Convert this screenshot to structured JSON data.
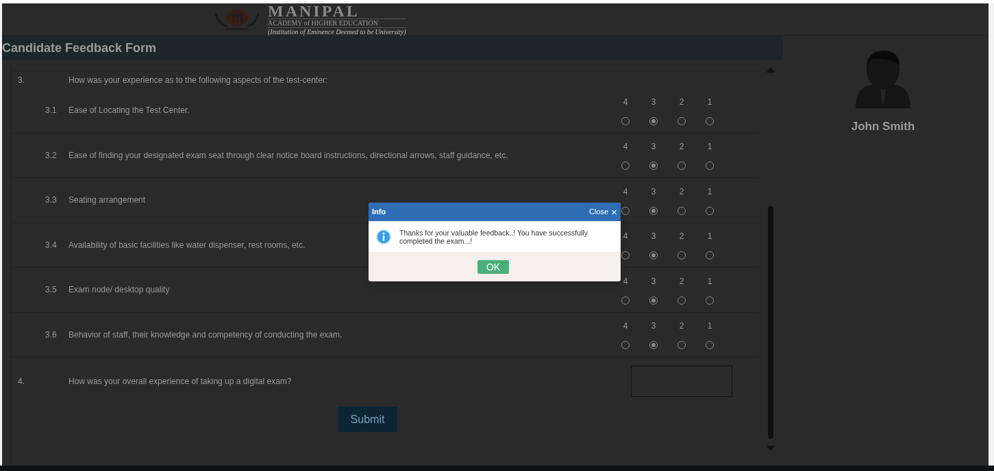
{
  "header": {
    "logo_title": "MANIPAL",
    "logo_subtitle": "ACADEMY of HIGHER EDUCATION",
    "logo_tagline": "(Institution of Eminence Deemed to be University)"
  },
  "form": {
    "title": "Candidate Feedback Form",
    "question": {
      "number": "3.",
      "text": "How was your experience as to the following aspects of the test-center:"
    },
    "items": [
      {
        "number": "3.1",
        "text": "Ease of Locating the Test Center.",
        "options": [
          {
            "label": "4",
            "selected": false
          },
          {
            "label": "3",
            "selected": true
          },
          {
            "label": "2",
            "selected": false
          },
          {
            "label": "1",
            "selected": false
          }
        ]
      },
      {
        "number": "3.2",
        "text": "Ease of finding your designated exam seat through clear notice board instructions, directional arrows, staff guidance, etc.",
        "options": [
          {
            "label": "4",
            "selected": false
          },
          {
            "label": "3",
            "selected": true
          },
          {
            "label": "2",
            "selected": false
          },
          {
            "label": "1",
            "selected": false
          }
        ]
      },
      {
        "number": "3.3",
        "text": "Seating arrangement",
        "options": [
          {
            "label": "4",
            "selected": false
          },
          {
            "label": "3",
            "selected": true
          },
          {
            "label": "2",
            "selected": false
          },
          {
            "label": "1",
            "selected": false
          }
        ]
      },
      {
        "number": "3.4",
        "text": "Availability of basic facilities like water dispenser, rest rooms, etc.",
        "options": [
          {
            "label": "4",
            "selected": false
          },
          {
            "label": "3",
            "selected": true
          },
          {
            "label": "2",
            "selected": false
          },
          {
            "label": "1",
            "selected": false
          }
        ]
      },
      {
        "number": "3.5",
        "text": "Exam node/ desktop quality",
        "options": [
          {
            "label": "4",
            "selected": false
          },
          {
            "label": "3",
            "selected": true
          },
          {
            "label": "2",
            "selected": false
          },
          {
            "label": "1",
            "selected": false
          }
        ]
      },
      {
        "number": "3.6",
        "text": "Behavior of staff, their knowledge and competency of conducting the exam.",
        "options": [
          {
            "label": "4",
            "selected": false
          },
          {
            "label": "3",
            "selected": true
          },
          {
            "label": "2",
            "selected": false
          },
          {
            "label": "1",
            "selected": false
          }
        ]
      }
    ],
    "last_question": {
      "number": "4.",
      "text": "How was your overall experience of taking up a digital exam?"
    },
    "submit": "Submit"
  },
  "profile": {
    "name": "John Smith"
  },
  "dialog": {
    "title": "Info",
    "close": "Close",
    "close_glyph": "×",
    "message": "Thanks for your valuable feedback..! You have successfully completed the exam...!",
    "ok": "OK"
  }
}
